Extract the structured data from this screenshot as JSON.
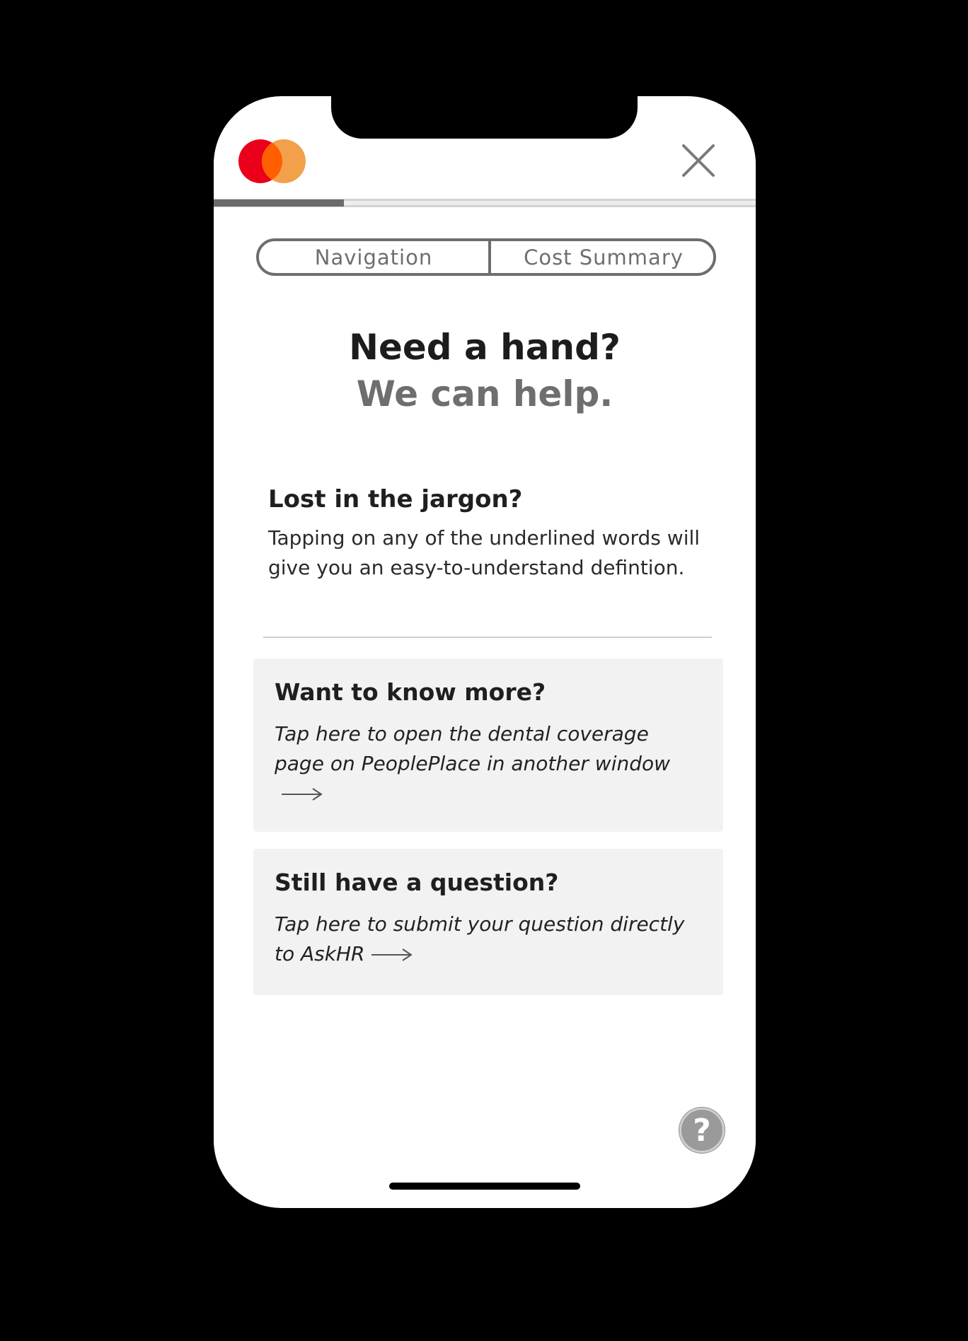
{
  "header": {
    "logo_icon": "mastercard-logo-icon",
    "close_icon": "close-icon"
  },
  "progress": {
    "value": 0.24,
    "fill_color": "#6b6b6b"
  },
  "tabs": [
    {
      "label": "Navigation"
    },
    {
      "label": "Cost Summary"
    }
  ],
  "headline": {
    "line1": "Need a hand?",
    "line2": "We can help."
  },
  "jargon": {
    "title": "Lost in the jargon?",
    "body": "Tapping on any of the underlined words will give you an easy-to-understand defintion."
  },
  "cards": [
    {
      "title": "Want to know more?",
      "body": "Tap here to open the dental coverage page on PeoplePlace in another window",
      "icon": "arrow-right-icon"
    },
    {
      "title": "Still have a question?",
      "body": "Tap here to submit your question directly to AskHR",
      "icon": "arrow-right-icon"
    }
  ],
  "help_button": {
    "label": "?",
    "icon": "question-mark-icon"
  },
  "colors": {
    "mastercard_red": "#eb001b",
    "mastercard_orange": "#f2a04a",
    "card_background": "#f2f2f2"
  }
}
